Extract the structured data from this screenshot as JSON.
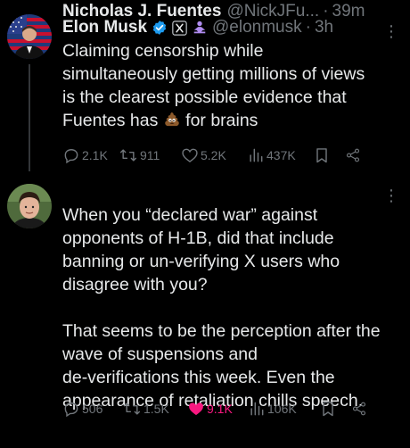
{
  "tweets": [
    {
      "name": "Elon Musk",
      "handle": "@elonmusk",
      "time": "3h",
      "text_before_emoji": "Claiming censorship while\nsimultaneously getting millions of views\nis the clearest possible evidence that\nFuentes has ",
      "text_after_emoji": " for brains",
      "emoji": "poop-emoji",
      "stats": {
        "replies": "2.1K",
        "reposts": "911",
        "likes": "5.2K",
        "views": "437K"
      },
      "badges": [
        "verified-badge",
        "x-affiliate-badge",
        "government-badge"
      ]
    },
    {
      "name": "Nicholas J. Fuentes",
      "handle": "@NickJFu...",
      "time": "39m",
      "text": "When you “declared war” against\nopponents of H-1B, did that include\nbanning or un-verifying X users who\ndisagree with you?\n\nThat seems to be the perception after the\nwave of suspensions and\nde-verifications this week. Even the\nappearance of retaliation chills speech.",
      "stats": {
        "replies": "506",
        "reposts": "1.5K",
        "likes": "9.1K",
        "views": "106K"
      },
      "liked": true
    }
  ],
  "colors": {
    "background": "#000000",
    "text": "#e7e9ea",
    "muted": "#71767b",
    "like": "#f91880",
    "verified": "#1d9bf0",
    "divider": "#2f3336"
  }
}
